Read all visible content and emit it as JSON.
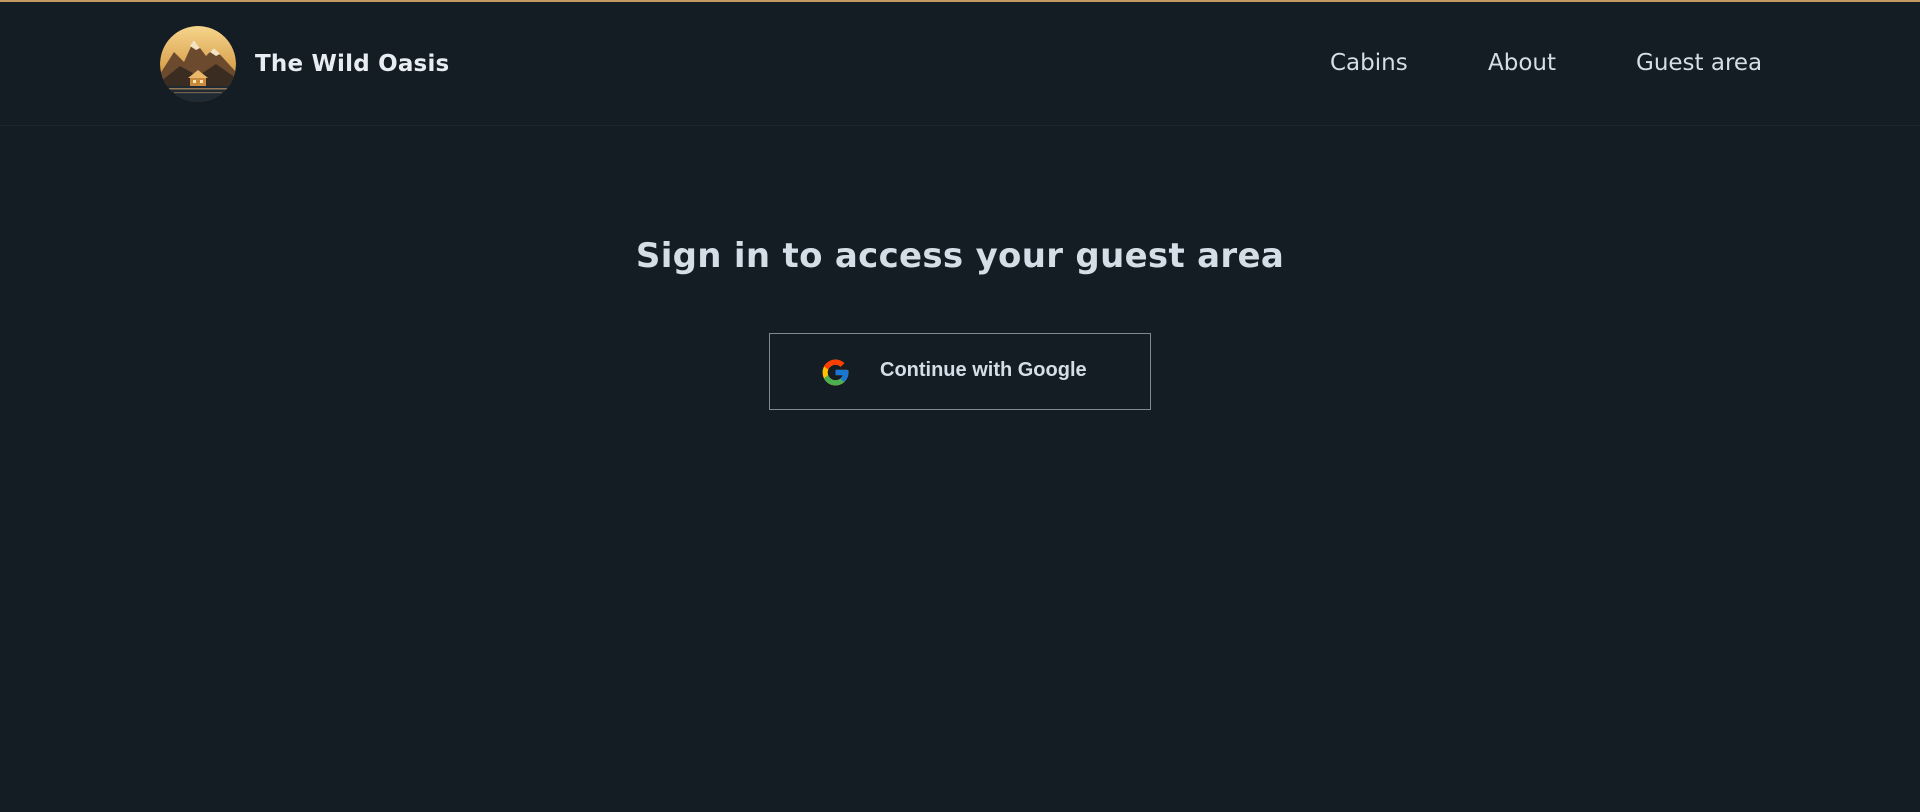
{
  "brand": {
    "name": "The Wild Oasis",
    "logo_icon": "cabin-mountain-logo"
  },
  "nav": {
    "items": [
      {
        "label": "Cabins"
      },
      {
        "label": "About"
      },
      {
        "label": "Guest area"
      }
    ]
  },
  "main": {
    "heading": "Sign in to access your guest area",
    "google_button": {
      "label": "Continue with Google",
      "icon": "google-icon"
    }
  },
  "colors": {
    "background": "#141c24",
    "accent": "#c69963",
    "text": "#d4dee7"
  }
}
